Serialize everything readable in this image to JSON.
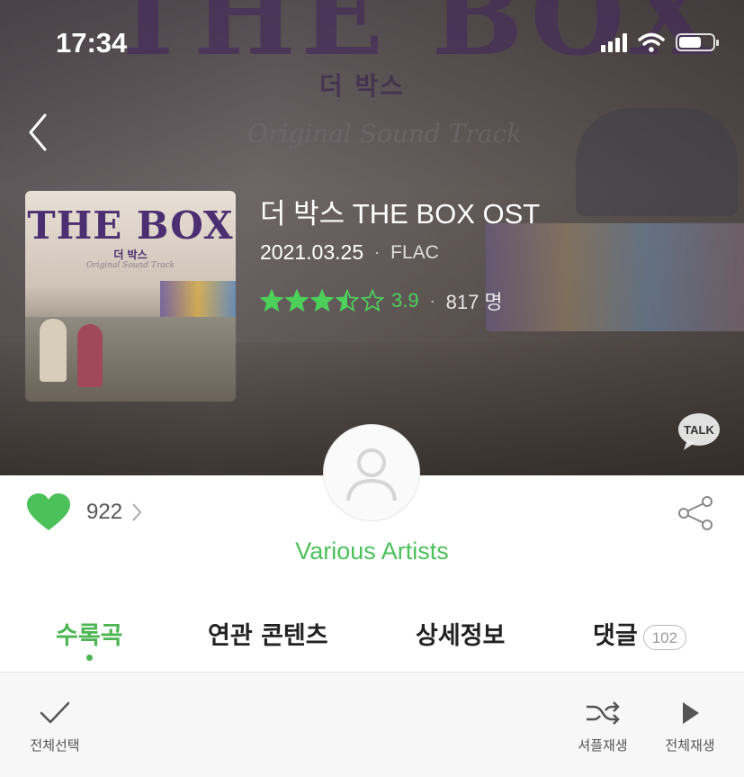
{
  "status_bar": {
    "time": "17:34"
  },
  "background_art": {
    "title": "THE BOX",
    "korean": "더 박스",
    "subtitle": "Original Sound Track"
  },
  "album": {
    "cover": {
      "title": "THE BOX",
      "korean": "더 박스",
      "subtitle": "Original Sound Track"
    },
    "title": "더 박스 THE BOX OST",
    "release_date": "2021.03.25",
    "separator": "·",
    "format": "FLAC",
    "rating": {
      "stars": 3.5,
      "value": "3.9",
      "count": "817 명"
    }
  },
  "talk": {
    "label": "TALK"
  },
  "like": {
    "count": "922"
  },
  "artist": {
    "name": "Various Artists"
  },
  "tabs": [
    {
      "label": "수록곡",
      "active": true
    },
    {
      "label": "연관 콘텐츠",
      "active": false
    },
    {
      "label": "상세정보",
      "active": false
    },
    {
      "label": "댓글",
      "badge": "102",
      "active": false
    }
  ],
  "toolbar": {
    "select_all": "전체선택",
    "shuffle": "셔플재생",
    "play_all": "전체재생"
  },
  "colors": {
    "accent": "#4cb552",
    "rating_green": "#4cd05a",
    "heart": "#4cc15a"
  },
  "icons": [
    "back-arrow-icon",
    "signal-icon",
    "wifi-icon",
    "battery-icon",
    "star-icon",
    "talk-icon",
    "heart-icon",
    "chevron-right-icon",
    "share-icon",
    "person-icon",
    "check-icon",
    "shuffle-icon",
    "play-icon"
  ]
}
